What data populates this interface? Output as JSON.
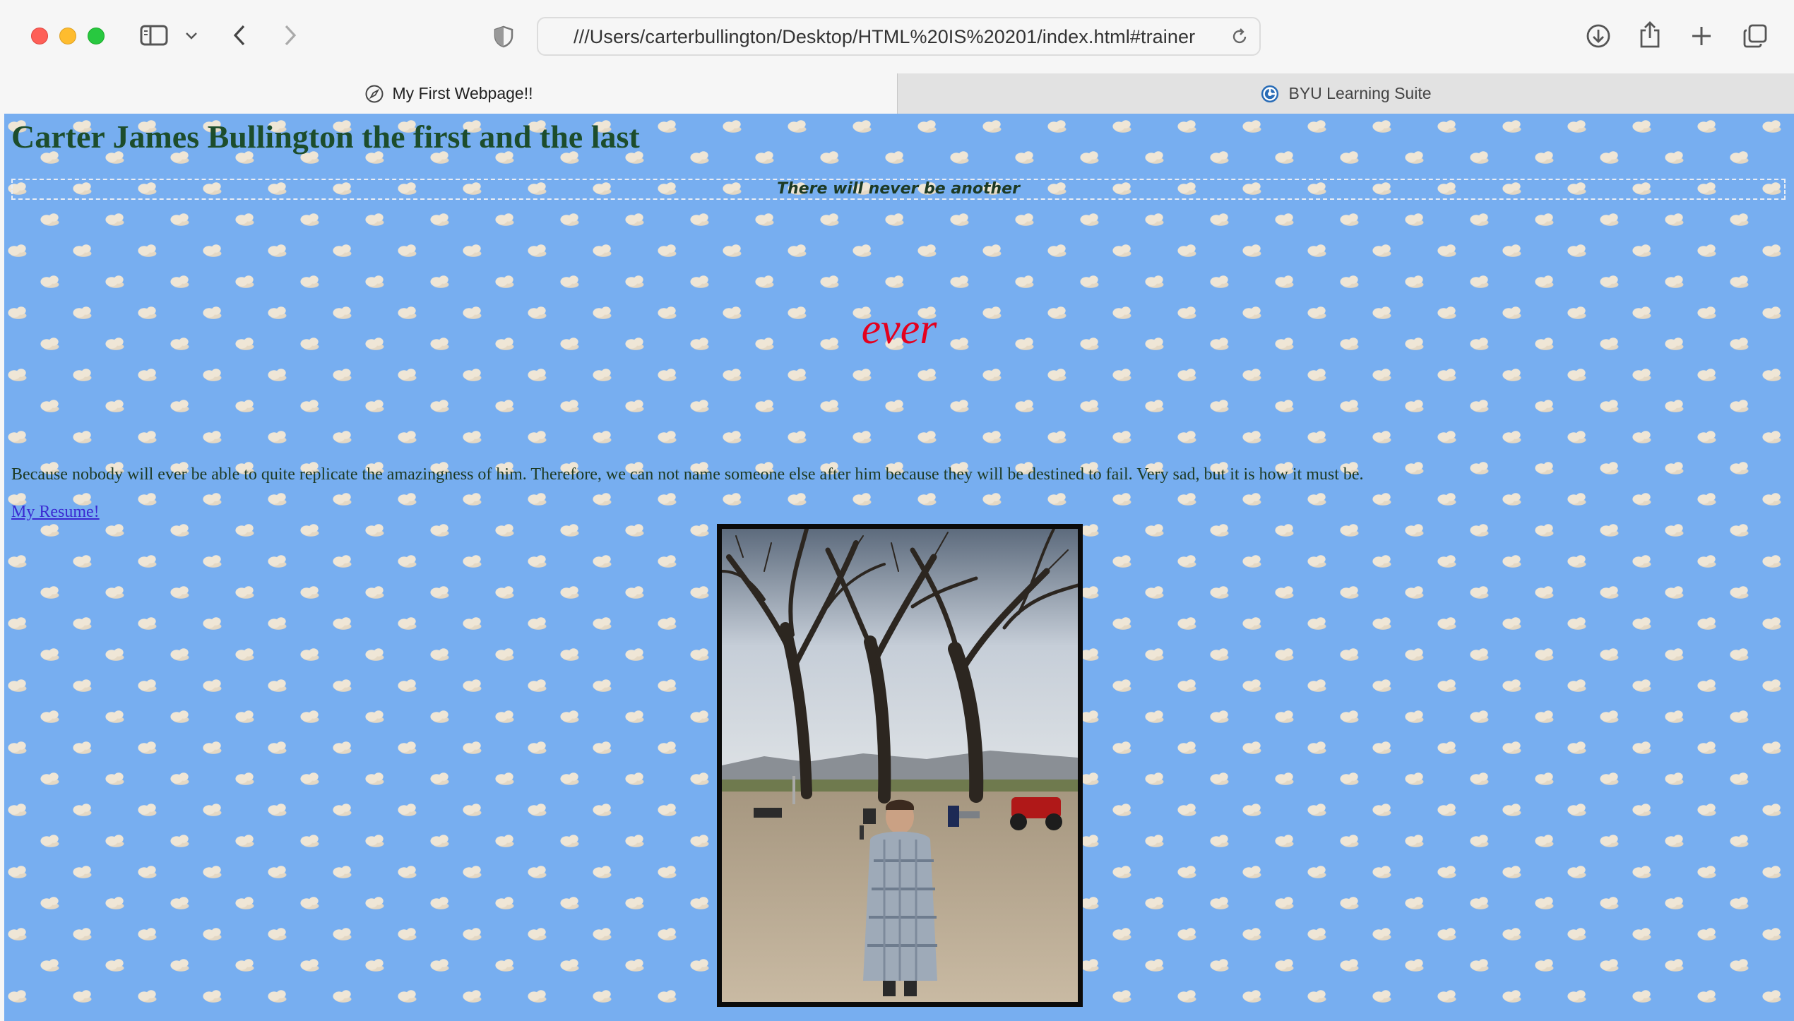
{
  "browser": {
    "address_url": "///Users/carterbullington/Desktop/HTML%20IS%20201/index.html#trainer",
    "icons": [
      "sidebar-icon",
      "chevron-down-icon",
      "back-arrow-icon",
      "forward-arrow-icon",
      "privacy-shield-icon",
      "reload-icon",
      "download-icon",
      "share-icon",
      "new-tab-plus-icon",
      "tab-overview-icon"
    ],
    "tabs": [
      {
        "label": "My First Webpage!!",
        "favicon": "compass-icon",
        "active": true
      },
      {
        "label": "BYU Learning Suite",
        "favicon": "learning-suite-icon",
        "active": false
      }
    ]
  },
  "page": {
    "title": "Carter James Bullington the first and the last",
    "subtitle": "There will never be another",
    "ever": "ever",
    "paragraph": "Because nobody will ever be able to quite replicate the amazingness of him. Therefore, we can not name someone else after him because they will be destined to fail. Very sad, but it is how it must be.",
    "resume_link": "My Resume!",
    "photo_description_icon": "person-photo"
  },
  "colors": {
    "page_background": "#77aef0",
    "title_color": "#1d4d2c",
    "ever_color": "#e4001e",
    "link_color": "#3a2ad2",
    "photo_border": "#0b0b0b"
  }
}
